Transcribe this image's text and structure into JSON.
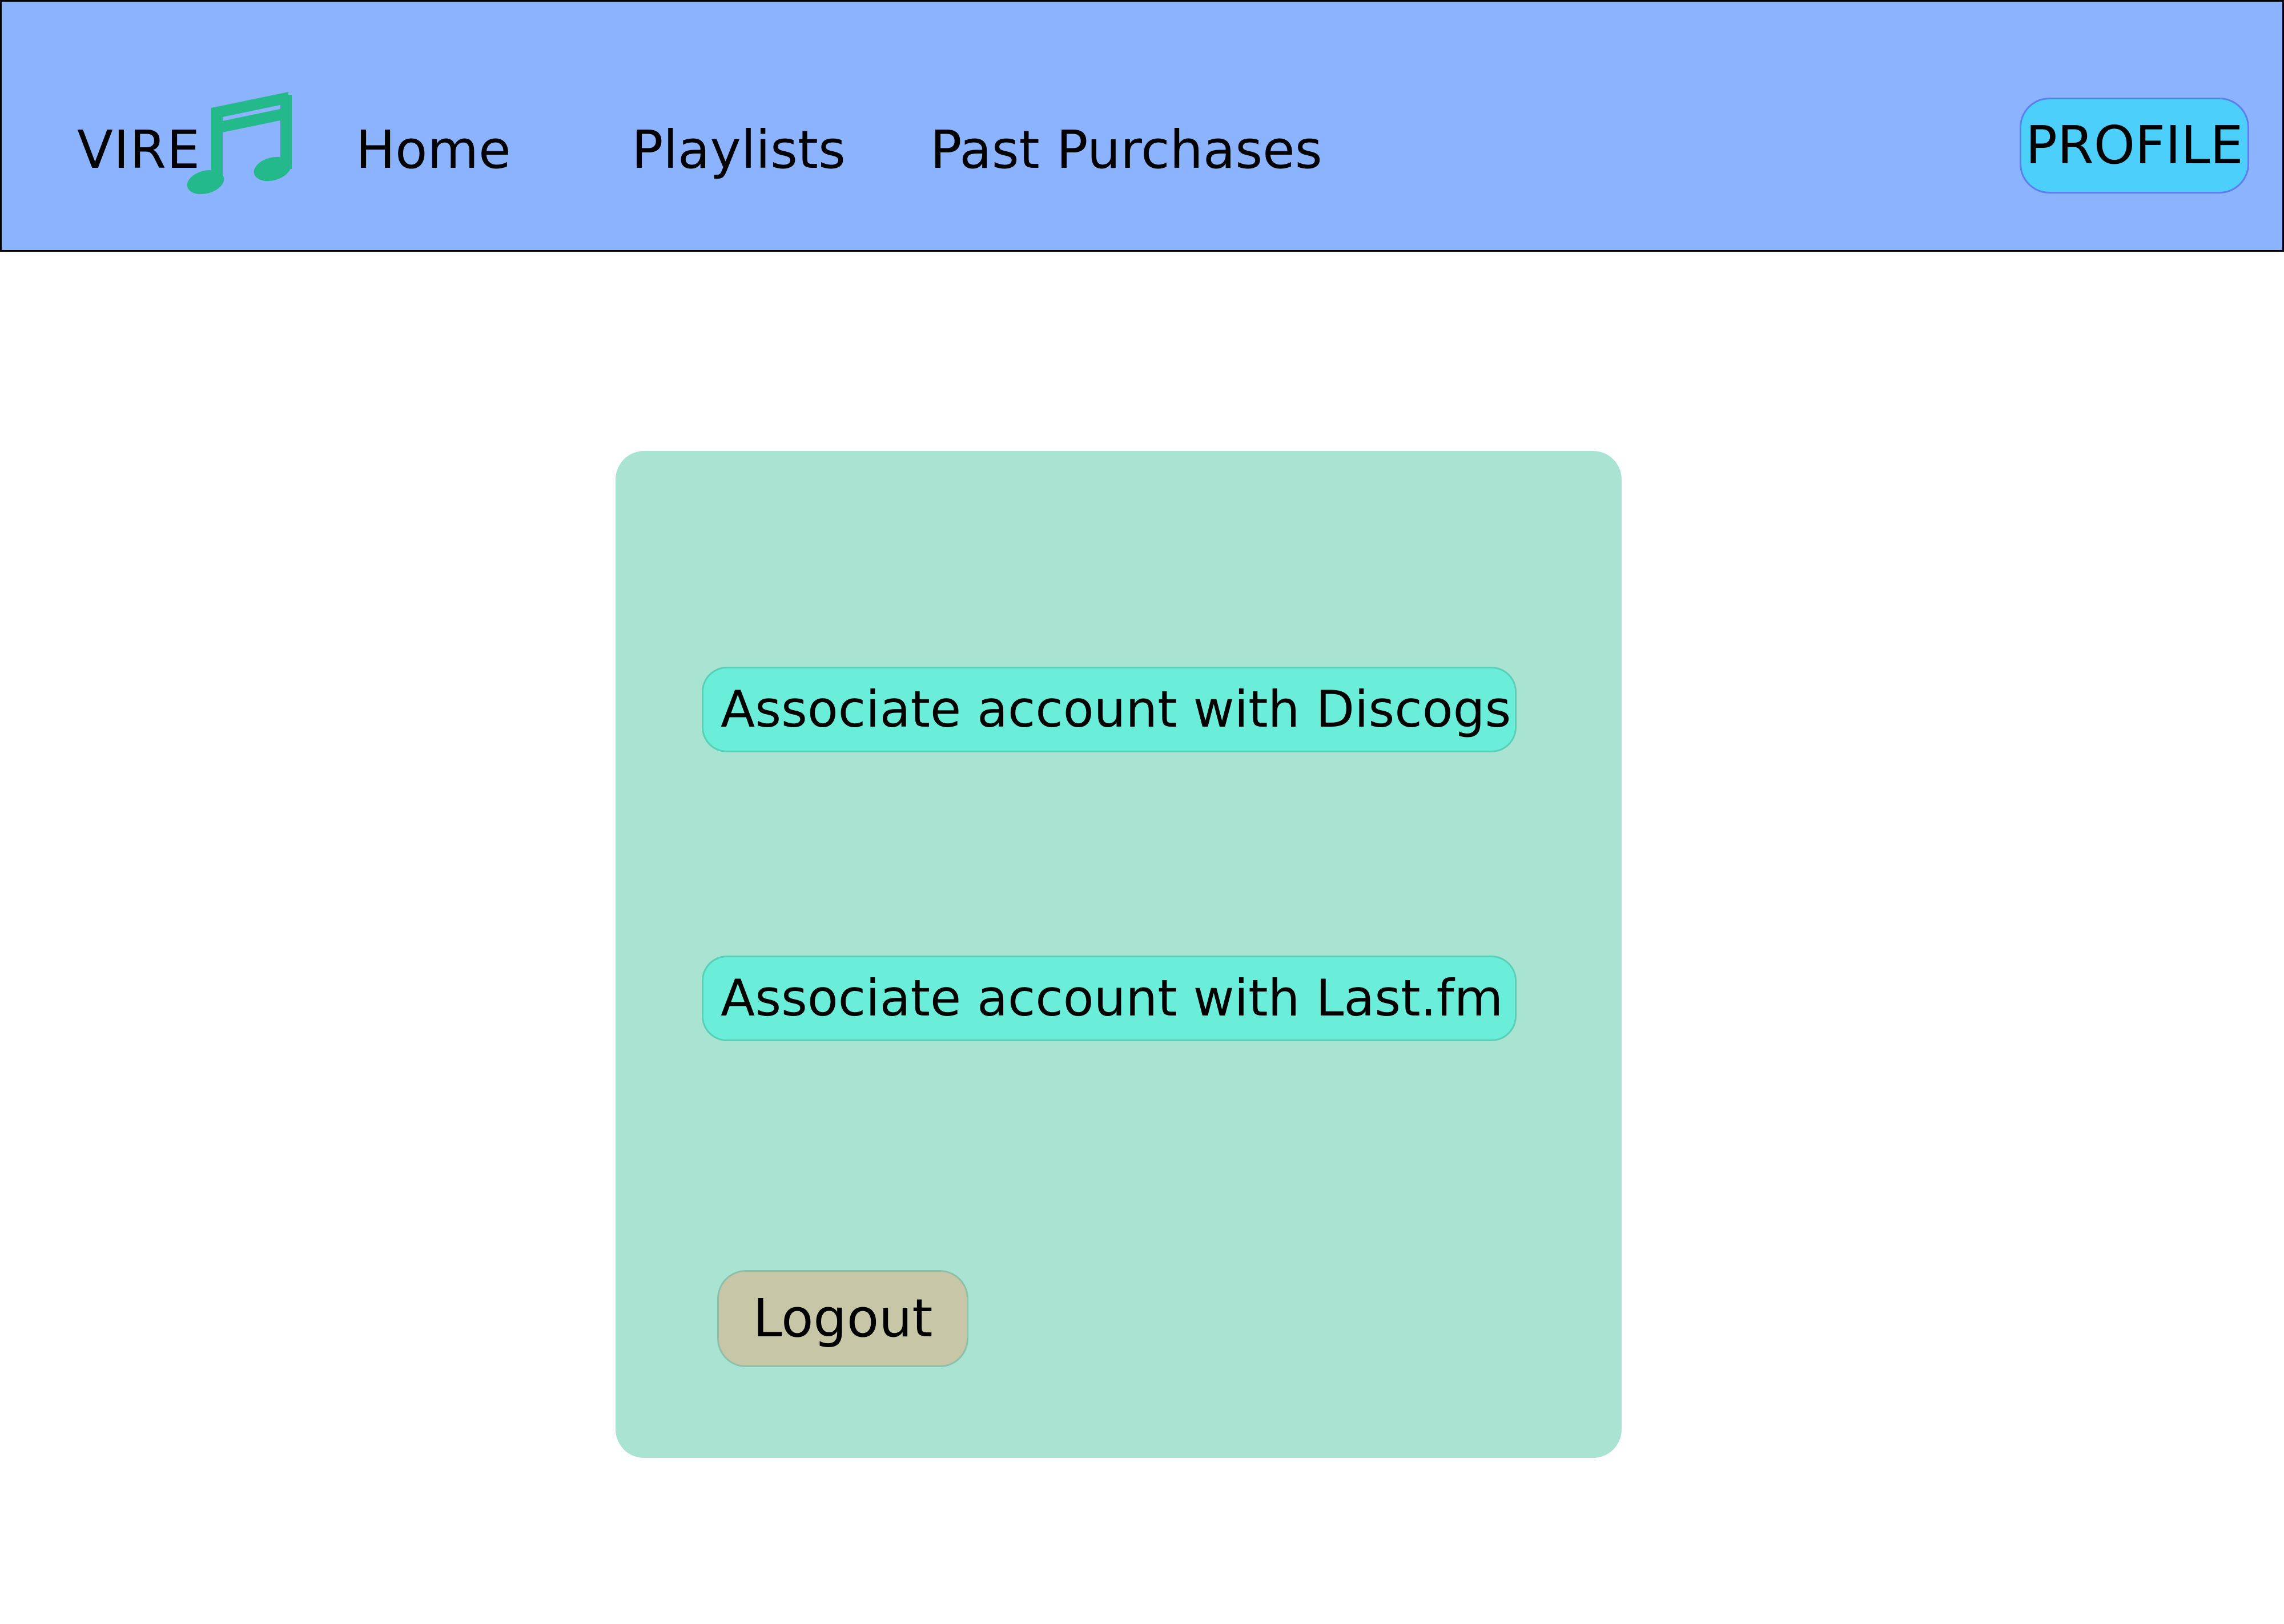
{
  "navbar": {
    "brand": "VIRE",
    "logo_icon": "music-notes-icon",
    "links": [
      {
        "label": "Home"
      },
      {
        "label": "Playlists"
      },
      {
        "label": "Past Purchases"
      }
    ],
    "profile_label": "PROFILE"
  },
  "panel": {
    "associate_discogs_label": "Associate account with Discogs",
    "associate_lastfm_label": "Associate account with Last.fm",
    "logout_label": "Logout"
  },
  "colors": {
    "navbar_bg": "#8cb3fd",
    "profile_button": "#4ccffb",
    "logo_green": "#23b98a",
    "panel_bg": "#a9e3d2",
    "associate_button": "#6beed9",
    "logout_button": "#c7c7a8"
  }
}
